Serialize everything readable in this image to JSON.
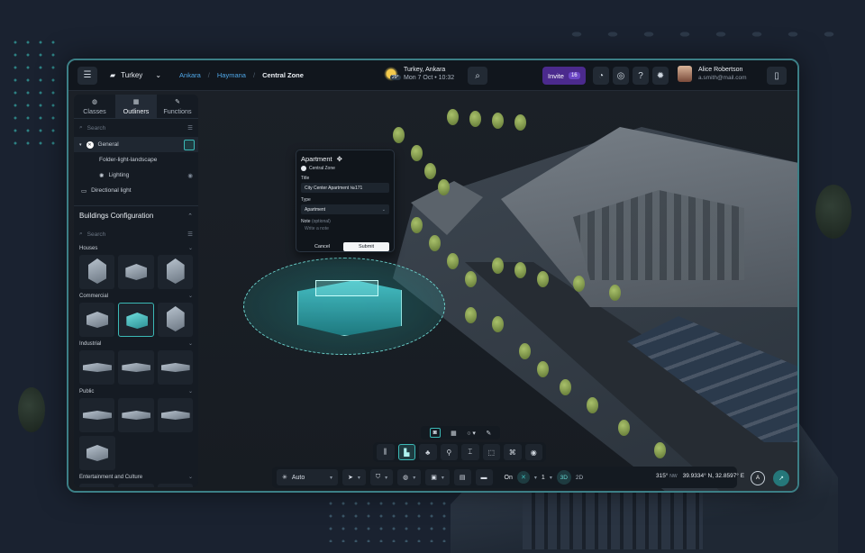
{
  "topbar": {
    "country": "Turkey",
    "breadcrumbs": [
      "Ankara",
      "Haymana",
      "Central Zone"
    ],
    "weather": {
      "location": "Turkey, Ankara",
      "temp": "29°",
      "date": "Mon 7 Oct",
      "time": "10:32"
    },
    "invite_label": "Invite",
    "invite_count": "16",
    "user": {
      "name": "Alice Robertson",
      "email": "a.smith@mail.com"
    }
  },
  "sidebar": {
    "tabs": [
      {
        "label": "Classes",
        "icon": "globe-icon"
      },
      {
        "label": "Outliners",
        "icon": "grid-icon"
      },
      {
        "label": "Functions",
        "icon": "wand-icon"
      }
    ],
    "search_placeholder": "Search",
    "tree": [
      {
        "label": "General"
      },
      {
        "label": "Folder-light-landscape"
      },
      {
        "label": "Lighting"
      },
      {
        "label": "Directional light"
      }
    ],
    "buildings_title": "Buildings Configuration",
    "buildings_search_placeholder": "Search",
    "categories": [
      "Houses",
      "Commercial",
      "Industrial",
      "Public",
      "Entertainment and Culture"
    ]
  },
  "popup": {
    "title": "Apartment",
    "zone": "Central Zone",
    "title_label": "Title",
    "title_value": "City Center Apartment №171",
    "type_label": "Type",
    "type_value": "Apartment",
    "note_label": "Note",
    "note_optional": "(optional)",
    "note_placeholder": "Write a note",
    "cancel_label": "Cancel",
    "submit_label": "Submit"
  },
  "bottom": {
    "mode": "Auto",
    "on_label": "On",
    "level": "1",
    "view_3d": "3D",
    "view_2d": "2D",
    "heading": "315°",
    "heading_dir": "NW",
    "coordinates": "39.9334° N, 32.8597° E",
    "compass": "A"
  },
  "colors": {
    "accent": "#3bb9b6",
    "invite": "#4b2a8d",
    "link": "#4fa6e6"
  }
}
